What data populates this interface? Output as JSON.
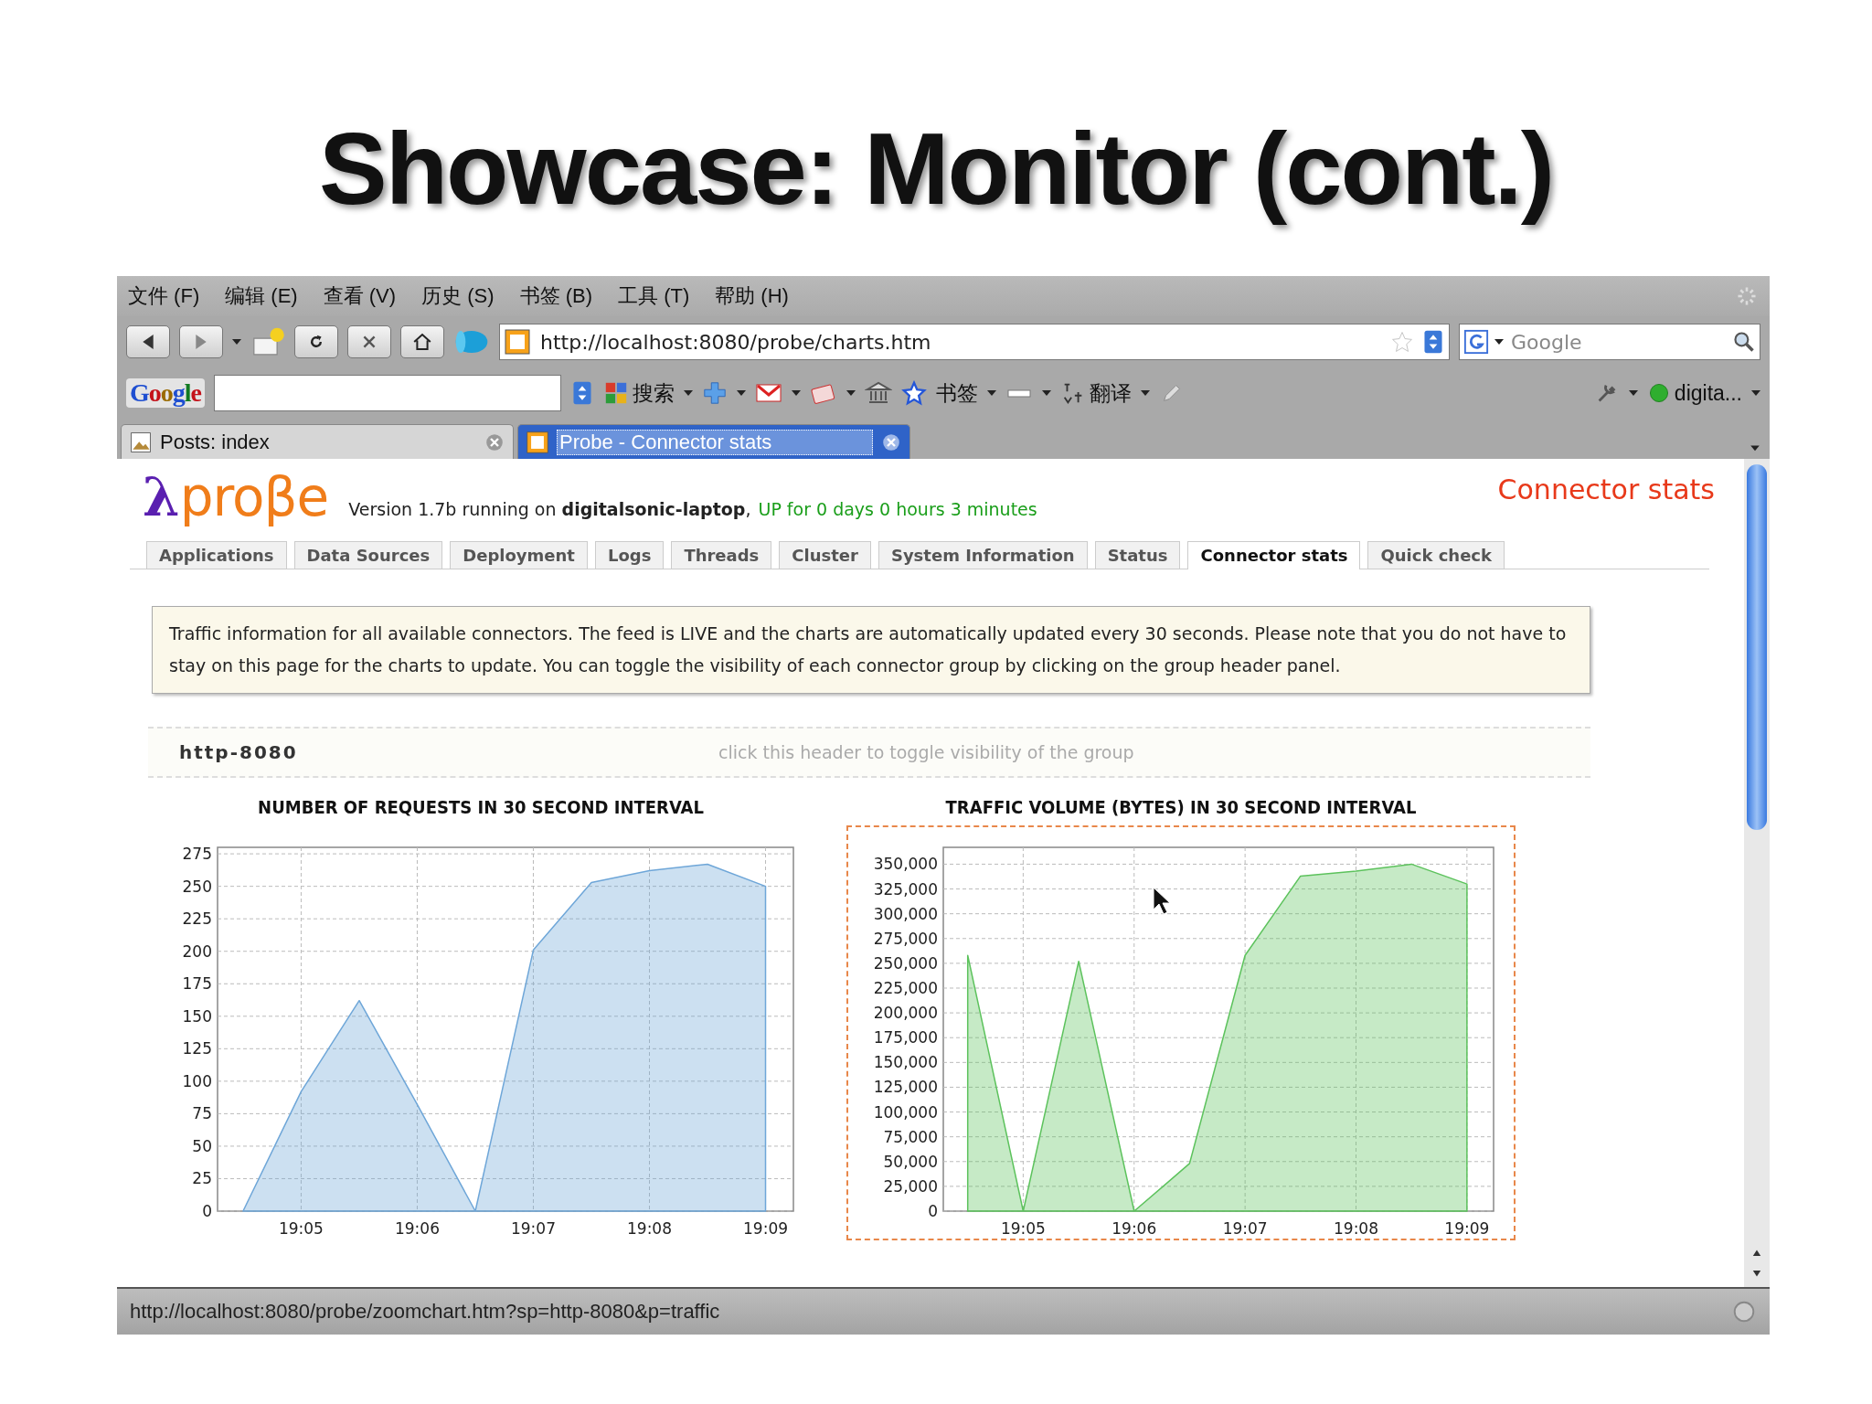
{
  "slide_title": "Showcase: Monitor (cont.)",
  "menu": [
    "文件 (F)",
    "编辑 (E)",
    "查看 (V)",
    "历史 (S)",
    "书签 (B)",
    "工具 (T)",
    "帮助 (H)"
  ],
  "address": {
    "value": "http://localhost:8080/probe/charts.htm"
  },
  "search": {
    "placeholder": "Google"
  },
  "google_toolbar": {
    "logo": "Google",
    "search_label": "搜索",
    "bookmarks_label": "书签",
    "translate_label": "翻译",
    "account_label": "digita..."
  },
  "browser_tabs": [
    {
      "label": "Posts: index",
      "selected": false
    },
    {
      "label": "Probe - Connector stats",
      "selected": true
    }
  ],
  "page": {
    "logo_symbol": "λ",
    "logo_text": "proβe",
    "version": "Version 1.7b running on **digitalsonic-laptop**,",
    "uptime": "UP for 0 days 0 hours 3 minutes",
    "title": "Connector stats",
    "tabs": [
      {
        "label": "Applications",
        "selected": false
      },
      {
        "label": "Data Sources",
        "selected": false
      },
      {
        "label": "Deployment",
        "selected": false
      },
      {
        "label": "Logs",
        "selected": false
      },
      {
        "label": "Threads",
        "selected": false
      },
      {
        "label": "Cluster",
        "selected": false
      },
      {
        "label": "System Information",
        "selected": false
      },
      {
        "label": "Status",
        "selected": false
      },
      {
        "label": "Connector stats",
        "selected": true
      },
      {
        "label": "Quick check",
        "selected": false
      }
    ],
    "notice": "Traffic information for all available connectors. The feed is LIVE and the charts are automatically updated every 30 seconds. Please note that you do not have to stay on this page for the charts to update. You can toggle the visibility of each connector group by clicking on the group header panel.",
    "group": {
      "name": "http-8080",
      "hint": "click this header to toggle visibility of the group"
    },
    "charts": [
      {
        "chart_data": {
          "type": "area",
          "title": "NUMBER OF REQUESTS IN 30 SECOND INTERVAL",
          "categories": [
            null,
            "19:05",
            null,
            "19:06",
            null,
            "19:07",
            null,
            "19:08",
            null,
            "19:09"
          ],
          "series": [
            {
              "color": "#6ea6d8",
              "values": [
                0,
                92,
                162,
                82,
                0,
                201,
                253,
                262,
                267,
                250
              ]
            }
          ],
          "ylim": [
            0,
            280
          ],
          "grid": true,
          "yticks": [
            0,
            25,
            50,
            75,
            100,
            125,
            150,
            175,
            200,
            225,
            250,
            275
          ]
        },
        "highlighted": false
      },
      {
        "chart_data": {
          "type": "area",
          "title": "TRAFFIC VOLUME (BYTES) IN 30 SECOND INTERVAL",
          "categories": [
            null,
            "19:05",
            null,
            "19:06",
            null,
            "19:07",
            null,
            "19:08",
            null,
            "19:09"
          ],
          "series": [
            {
              "color": "#5cc25c",
              "values": [
                258000,
                0,
                252000,
                0,
                48000,
                258000,
                338000,
                343000,
                350000,
                330000
              ]
            }
          ],
          "ylim": [
            0,
            367000
          ],
          "grid": true,
          "yticks": [
            {
              "value": 0,
              "label": "0"
            },
            {
              "value": 25000,
              "label": "25,000"
            },
            {
              "value": 50000,
              "label": "50,000"
            },
            {
              "value": 75000,
              "label": "75,000"
            },
            {
              "value": 100000,
              "label": "100,000"
            },
            {
              "value": 125000,
              "label": "125,000"
            },
            {
              "value": 150000,
              "label": "150,000"
            },
            {
              "value": 175000,
              "label": "175,000"
            },
            {
              "value": 200000,
              "label": "200,000"
            },
            {
              "value": 225000,
              "label": "225,000"
            },
            {
              "value": 250000,
              "label": "250,000"
            },
            {
              "value": 275000,
              "label": "275,000"
            },
            {
              "value": 300000,
              "label": "300,000"
            },
            {
              "value": 325000,
              "label": "325,000"
            },
            {
              "value": 350000,
              "label": "350,000"
            }
          ]
        },
        "highlighted": true
      }
    ]
  },
  "status_text": "http://localhost:8080/probe/zoomchart.htm?sp=http-8080&p=traffic"
}
